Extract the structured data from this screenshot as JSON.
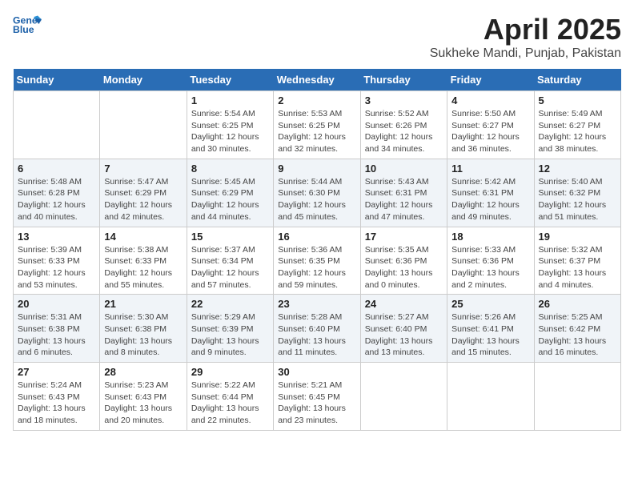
{
  "header": {
    "logo_line1": "General",
    "logo_line2": "Blue",
    "month": "April 2025",
    "location": "Sukheke Mandi, Punjab, Pakistan"
  },
  "days_of_week": [
    "Sunday",
    "Monday",
    "Tuesday",
    "Wednesday",
    "Thursday",
    "Friday",
    "Saturday"
  ],
  "weeks": [
    [
      {
        "day": "",
        "info": ""
      },
      {
        "day": "",
        "info": ""
      },
      {
        "day": "1",
        "info": "Sunrise: 5:54 AM\nSunset: 6:25 PM\nDaylight: 12 hours and 30 minutes."
      },
      {
        "day": "2",
        "info": "Sunrise: 5:53 AM\nSunset: 6:25 PM\nDaylight: 12 hours and 32 minutes."
      },
      {
        "day": "3",
        "info": "Sunrise: 5:52 AM\nSunset: 6:26 PM\nDaylight: 12 hours and 34 minutes."
      },
      {
        "day": "4",
        "info": "Sunrise: 5:50 AM\nSunset: 6:27 PM\nDaylight: 12 hours and 36 minutes."
      },
      {
        "day": "5",
        "info": "Sunrise: 5:49 AM\nSunset: 6:27 PM\nDaylight: 12 hours and 38 minutes."
      }
    ],
    [
      {
        "day": "6",
        "info": "Sunrise: 5:48 AM\nSunset: 6:28 PM\nDaylight: 12 hours and 40 minutes."
      },
      {
        "day": "7",
        "info": "Sunrise: 5:47 AM\nSunset: 6:29 PM\nDaylight: 12 hours and 42 minutes."
      },
      {
        "day": "8",
        "info": "Sunrise: 5:45 AM\nSunset: 6:29 PM\nDaylight: 12 hours and 44 minutes."
      },
      {
        "day": "9",
        "info": "Sunrise: 5:44 AM\nSunset: 6:30 PM\nDaylight: 12 hours and 45 minutes."
      },
      {
        "day": "10",
        "info": "Sunrise: 5:43 AM\nSunset: 6:31 PM\nDaylight: 12 hours and 47 minutes."
      },
      {
        "day": "11",
        "info": "Sunrise: 5:42 AM\nSunset: 6:31 PM\nDaylight: 12 hours and 49 minutes."
      },
      {
        "day": "12",
        "info": "Sunrise: 5:40 AM\nSunset: 6:32 PM\nDaylight: 12 hours and 51 minutes."
      }
    ],
    [
      {
        "day": "13",
        "info": "Sunrise: 5:39 AM\nSunset: 6:33 PM\nDaylight: 12 hours and 53 minutes."
      },
      {
        "day": "14",
        "info": "Sunrise: 5:38 AM\nSunset: 6:33 PM\nDaylight: 12 hours and 55 minutes."
      },
      {
        "day": "15",
        "info": "Sunrise: 5:37 AM\nSunset: 6:34 PM\nDaylight: 12 hours and 57 minutes."
      },
      {
        "day": "16",
        "info": "Sunrise: 5:36 AM\nSunset: 6:35 PM\nDaylight: 12 hours and 59 minutes."
      },
      {
        "day": "17",
        "info": "Sunrise: 5:35 AM\nSunset: 6:36 PM\nDaylight: 13 hours and 0 minutes."
      },
      {
        "day": "18",
        "info": "Sunrise: 5:33 AM\nSunset: 6:36 PM\nDaylight: 13 hours and 2 minutes."
      },
      {
        "day": "19",
        "info": "Sunrise: 5:32 AM\nSunset: 6:37 PM\nDaylight: 13 hours and 4 minutes."
      }
    ],
    [
      {
        "day": "20",
        "info": "Sunrise: 5:31 AM\nSunset: 6:38 PM\nDaylight: 13 hours and 6 minutes."
      },
      {
        "day": "21",
        "info": "Sunrise: 5:30 AM\nSunset: 6:38 PM\nDaylight: 13 hours and 8 minutes."
      },
      {
        "day": "22",
        "info": "Sunrise: 5:29 AM\nSunset: 6:39 PM\nDaylight: 13 hours and 9 minutes."
      },
      {
        "day": "23",
        "info": "Sunrise: 5:28 AM\nSunset: 6:40 PM\nDaylight: 13 hours and 11 minutes."
      },
      {
        "day": "24",
        "info": "Sunrise: 5:27 AM\nSunset: 6:40 PM\nDaylight: 13 hours and 13 minutes."
      },
      {
        "day": "25",
        "info": "Sunrise: 5:26 AM\nSunset: 6:41 PM\nDaylight: 13 hours and 15 minutes."
      },
      {
        "day": "26",
        "info": "Sunrise: 5:25 AM\nSunset: 6:42 PM\nDaylight: 13 hours and 16 minutes."
      }
    ],
    [
      {
        "day": "27",
        "info": "Sunrise: 5:24 AM\nSunset: 6:43 PM\nDaylight: 13 hours and 18 minutes."
      },
      {
        "day": "28",
        "info": "Sunrise: 5:23 AM\nSunset: 6:43 PM\nDaylight: 13 hours and 20 minutes."
      },
      {
        "day": "29",
        "info": "Sunrise: 5:22 AM\nSunset: 6:44 PM\nDaylight: 13 hours and 22 minutes."
      },
      {
        "day": "30",
        "info": "Sunrise: 5:21 AM\nSunset: 6:45 PM\nDaylight: 13 hours and 23 minutes."
      },
      {
        "day": "",
        "info": ""
      },
      {
        "day": "",
        "info": ""
      },
      {
        "day": "",
        "info": ""
      }
    ]
  ]
}
